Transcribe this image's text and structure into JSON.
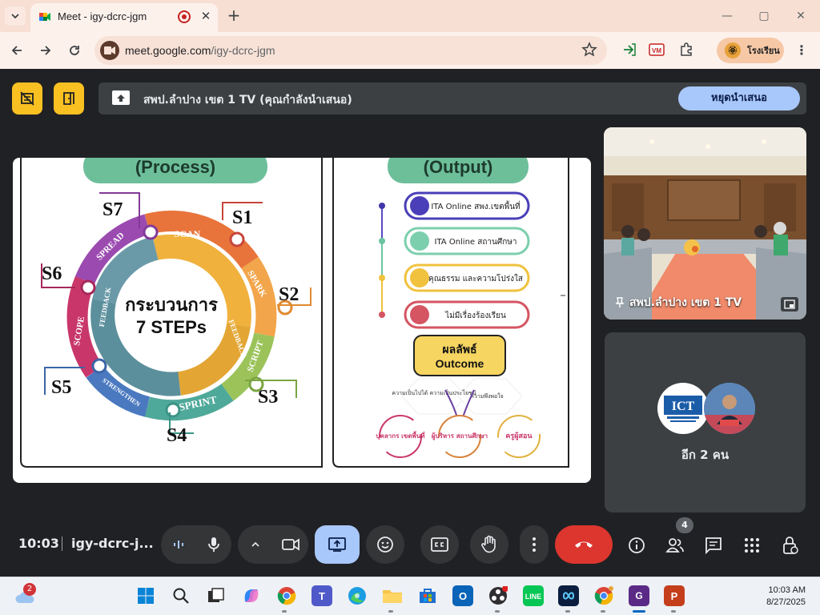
{
  "browser": {
    "tab_title": "Meet - igy-dcrc-jgm",
    "tab_close": "✕",
    "new_tab": "+",
    "url_host": "meet.google.com",
    "url_path": "/igy-dcrc-jgm",
    "profile_name": "โรงเรียน",
    "window_controls": [
      "—",
      "▢",
      "✕"
    ]
  },
  "meet": {
    "presenting_text": "สพป.ลำปาง เขต 1 TV (คุณกำลังนำเสนอ)",
    "stop_presenting": "หยุดนำเสนอ",
    "room_tile_label": "สพป.ลำปาง เขต 1 TV",
    "others_label": "อีก 2 คน",
    "clock": "10:03",
    "meeting_code": "igy-dcrc-j...",
    "people_count": "4"
  },
  "slide": {
    "process_header": "(Process)",
    "output_header": "(Output)",
    "center_line1": "กระบวนการ",
    "center_line2": "7 STEPs",
    "steps": [
      "S1",
      "S2",
      "S3",
      "S4",
      "S5",
      "S6",
      "S7"
    ],
    "ring_labels": [
      "SCAN",
      "SPARK",
      "SCRIPT",
      "SPRINT",
      "STRENGTHEN",
      "SCOPE",
      "SPREAD",
      "FEEDBACK",
      "FEEDBACK"
    ],
    "outputs": [
      "ITA Online สพง.เขตพื้นที่",
      "ITA Online สถานศึกษา",
      "คุณธรรม และความโปร่งใส",
      "ไม่มีเรื่องร้องเรียน"
    ],
    "outcome_line1": "ผลลัพธ์",
    "outcome_line2": "Outcome",
    "hex_labels": [
      "ความเป็นไปได้ ความเป็นประโยชน์",
      "ความพึงพอใจ"
    ],
    "bottom_labels": [
      "บุคลากร เขตพื้นที่",
      "ผู้บริหาร สถานศึกษา",
      "ครูผู้สอน"
    ]
  },
  "taskbar": {
    "weather_badge": "2",
    "time": "10:03 AM",
    "date": "8/27/2025"
  },
  "colors": {
    "accent_yellow": "#f9c022",
    "stop_button": "#a8c7fa",
    "end_call": "#dc362e",
    "meet_bg": "#202124"
  }
}
